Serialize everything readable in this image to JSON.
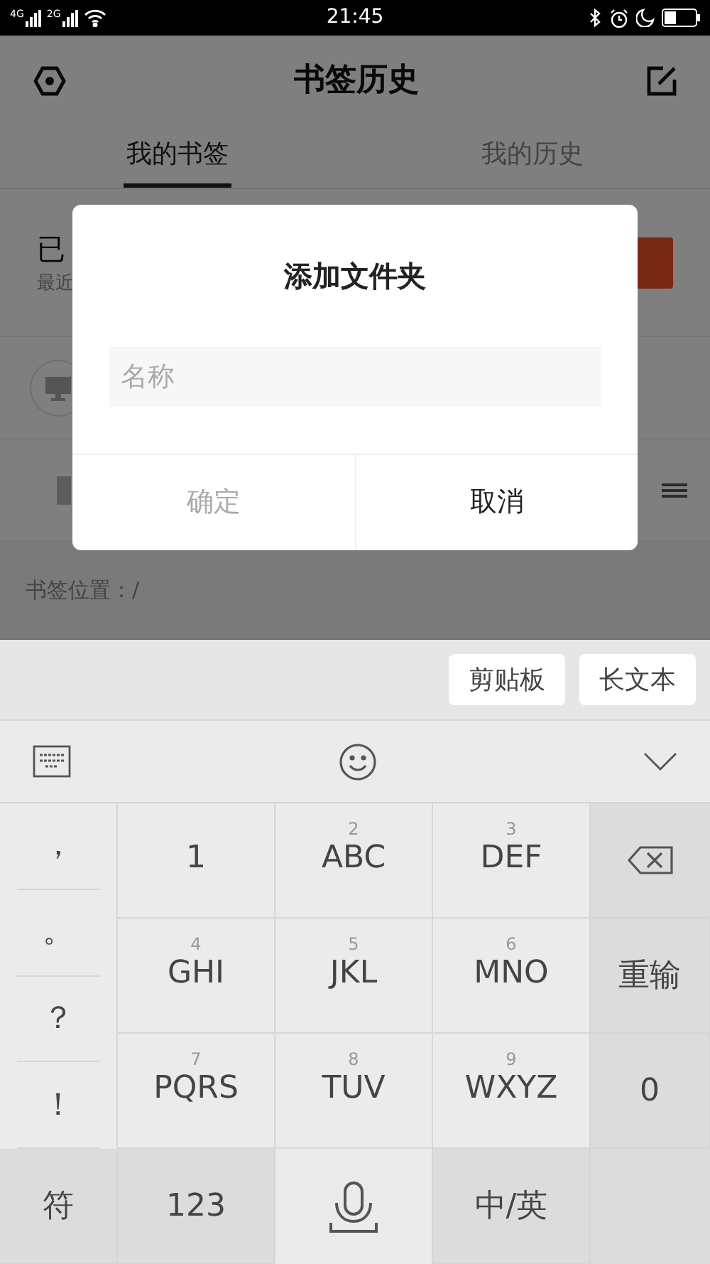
{
  "status_bar": {
    "time": "21:45",
    "network_labels": [
      "4G",
      "2G"
    ]
  },
  "header": {
    "title": "书签历史"
  },
  "tabs": [
    {
      "label": "我的书签",
      "selected": true
    },
    {
      "label": "我的历史",
      "selected": false
    }
  ],
  "content": {
    "account_title": "已",
    "account_subtitle": "最近",
    "location": "书签位置：/"
  },
  "dialog": {
    "title": "添加文件夹",
    "name_field": {
      "placeholder": "名称"
    },
    "buttons": [
      {
        "label": "确定",
        "disabled": true
      },
      {
        "label": "取消",
        "disabled": false
      }
    ]
  },
  "keyboard": {
    "toolbar_buttons": [
      "剪贴板",
      "长文本"
    ],
    "punctuation": [
      "，",
      "。",
      "？",
      "！"
    ],
    "key_rows": [
      [
        {
          "label": "1"
        },
        {
          "digit": "2",
          "label": "ABC"
        },
        {
          "digit": "3",
          "label": "DEF"
        }
      ],
      [
        {
          "digit": "4",
          "label": "GHI"
        },
        {
          "digit": "5",
          "label": "JKL"
        },
        {
          "digit": "6",
          "label": "MNO"
        }
      ],
      [
        {
          "digit": "7",
          "label": "PQRS"
        },
        {
          "digit": "8",
          "label": "TUV"
        },
        {
          "digit": "9",
          "label": "WXYZ"
        }
      ]
    ],
    "side_keys": [
      {
        "kind": "backspace"
      },
      {
        "kind": "text",
        "label": "重输"
      },
      {
        "kind": "text",
        "label": "0"
      }
    ],
    "bottom_keys": [
      {
        "kind": "text",
        "label": "符"
      },
      {
        "kind": "text",
        "label": "123"
      },
      {
        "kind": "mic"
      },
      {
        "kind": "text",
        "label": "中/英"
      },
      {
        "kind": "blank"
      }
    ]
  }
}
